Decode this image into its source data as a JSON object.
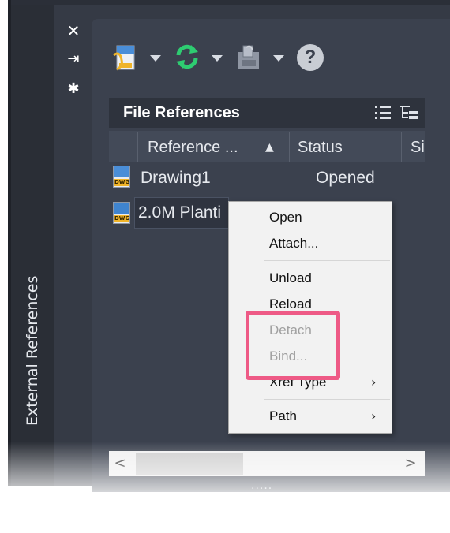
{
  "palette": {
    "vertical_title": "External References",
    "tools": [
      {
        "icon": "close-icon",
        "glyph": "✕"
      },
      {
        "icon": "auto-hide-icon",
        "glyph": "⇥"
      },
      {
        "icon": "properties-gear-icon",
        "glyph": "✱"
      }
    ]
  },
  "toolbar": {
    "buttons": [
      {
        "icon": "attach-dwg-icon"
      },
      {
        "icon": "refresh-icon"
      },
      {
        "icon": "change-path-icon"
      },
      {
        "icon": "help-icon",
        "glyph": "?"
      }
    ]
  },
  "file_references": {
    "title": "File References",
    "view_buttons": [
      "list-view-icon",
      "tree-view-icon"
    ],
    "columns": [
      "Reference ...",
      "Status",
      "Si"
    ],
    "sort_indicator": "▲",
    "rows": [
      {
        "name": "Drawing1",
        "status": "Opened",
        "icon_tag": "DWG"
      },
      {
        "name": "2.0M Planti",
        "status": "",
        "icon_tag": "DWG",
        "selected": true
      }
    ]
  },
  "context_menu": {
    "items": [
      {
        "label": "Open",
        "enabled": true
      },
      {
        "label": "Attach...",
        "enabled": true
      },
      {
        "separator": true
      },
      {
        "label": "Unload",
        "enabled": true
      },
      {
        "label": "Reload",
        "enabled": true
      },
      {
        "label": "Detach",
        "enabled": false
      },
      {
        "label": "Bind...",
        "enabled": false
      },
      {
        "label": "Xref Type",
        "enabled": true,
        "submenu": true
      },
      {
        "separator": true
      },
      {
        "label": "Path",
        "enabled": true,
        "submenu": true
      }
    ],
    "highlight_color": "#ee5a86"
  },
  "scrollbar": {
    "left_arrow": "<",
    "right_arrow": ">",
    "grip": "....."
  },
  "colors": {
    "panel": "#353a45",
    "header": "#2e333d",
    "accent_refresh": "#2ecc71"
  }
}
